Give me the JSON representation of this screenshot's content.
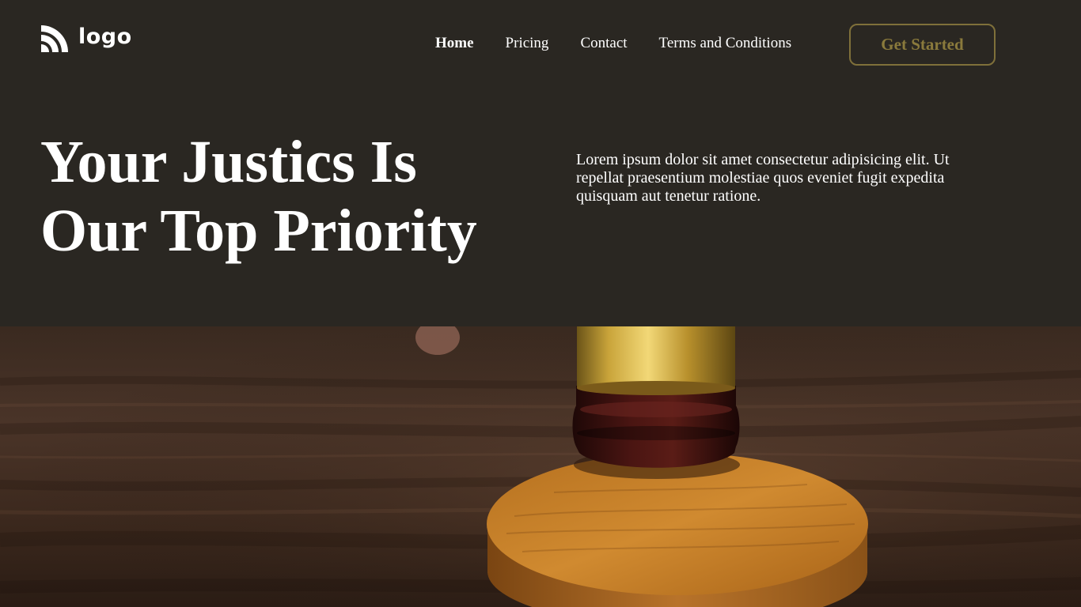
{
  "logo": {
    "text": "logo",
    "icon": "rss-wave-icon"
  },
  "nav": {
    "items": [
      {
        "label": "Home",
        "active": true
      },
      {
        "label": "Pricing",
        "active": false
      },
      {
        "label": "Contact",
        "active": false
      },
      {
        "label": "Terms and Conditions",
        "active": false
      }
    ]
  },
  "cta": {
    "label": "Get Started"
  },
  "hero": {
    "title_line1": "Your Justics Is",
    "title_line2": "Our Top Priority",
    "description": "Lorem ipsum dolor sit amet consectetur adipisicing elit. Ut repellat praesentium molestiae quos eveniet fugit expedita quisquam aut tenetur ratione."
  },
  "photo": {
    "subject": "gavel-on-sound-block"
  },
  "colors": {
    "background": "#2a2722",
    "text": "#ffffff",
    "accent": "#8a7a3c",
    "accent_border": "#7f703a"
  }
}
